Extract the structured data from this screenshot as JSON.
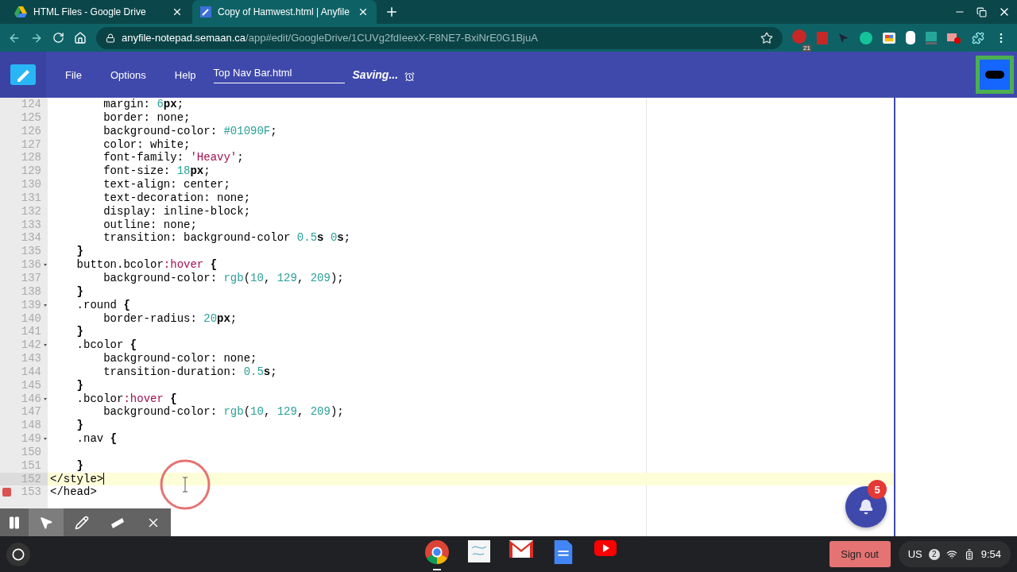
{
  "browser": {
    "tabs": [
      {
        "title": "HTML Files - Google Drive",
        "kind": "drive",
        "selected": false
      },
      {
        "title": "Copy of Hamwest.html | Anyfile",
        "kind": "notepad",
        "selected": true
      }
    ],
    "url": {
      "host": "anyfile-notepad.semaan.ca",
      "path": "/app#edit/GoogleDrive/1CUVg2fdIeexX-F8NE7-BxiNrE0G1BjuA"
    },
    "extension_badge": "21"
  },
  "app": {
    "menu": [
      "File",
      "Options",
      "Help"
    ],
    "filename": "Top Nav Bar.html",
    "status": "Saving..."
  },
  "editor": {
    "lines": [
      {
        "number": "124",
        "fold": false,
        "error": false,
        "current": false,
        "tokens": [
          {
            "kind": "plain",
            "text": "        margin: "
          },
          {
            "kind": "num",
            "text": "6"
          },
          {
            "kind": "bold",
            "text": "px"
          },
          {
            "kind": "plain",
            "text": ";"
          }
        ]
      },
      {
        "number": "125",
        "fold": false,
        "error": false,
        "current": false,
        "tokens": [
          {
            "kind": "plain",
            "text": "        border: none;"
          }
        ]
      },
      {
        "number": "126",
        "fold": false,
        "error": false,
        "current": false,
        "tokens": [
          {
            "kind": "plain",
            "text": "        background-color: "
          },
          {
            "kind": "num",
            "text": "#01090F"
          },
          {
            "kind": "plain",
            "text": ";"
          }
        ]
      },
      {
        "number": "127",
        "fold": false,
        "error": false,
        "current": false,
        "tokens": [
          {
            "kind": "plain",
            "text": "        color: white;"
          }
        ]
      },
      {
        "number": "128",
        "fold": false,
        "error": false,
        "current": false,
        "tokens": [
          {
            "kind": "plain",
            "text": "        font-family: "
          },
          {
            "kind": "string",
            "text": "'Heavy'"
          },
          {
            "kind": "plain",
            "text": ";"
          }
        ]
      },
      {
        "number": "129",
        "fold": false,
        "error": false,
        "current": false,
        "tokens": [
          {
            "kind": "plain",
            "text": "        font-size: "
          },
          {
            "kind": "num",
            "text": "18"
          },
          {
            "kind": "bold",
            "text": "px"
          },
          {
            "kind": "plain",
            "text": ";"
          }
        ]
      },
      {
        "number": "130",
        "fold": false,
        "error": false,
        "current": false,
        "tokens": [
          {
            "kind": "plain",
            "text": "        text-align: center;"
          }
        ]
      },
      {
        "number": "131",
        "fold": false,
        "error": false,
        "current": false,
        "tokens": [
          {
            "kind": "plain",
            "text": "        text-decoration: none;"
          }
        ]
      },
      {
        "number": "132",
        "fold": false,
        "error": false,
        "current": false,
        "tokens": [
          {
            "kind": "plain",
            "text": "        display: inline-block;"
          }
        ]
      },
      {
        "number": "133",
        "fold": false,
        "error": false,
        "current": false,
        "tokens": [
          {
            "kind": "plain",
            "text": "        outline: none;"
          }
        ]
      },
      {
        "number": "134",
        "fold": false,
        "error": false,
        "current": false,
        "tokens": [
          {
            "kind": "plain",
            "text": "        transition: background-color "
          },
          {
            "kind": "num",
            "text": "0.5"
          },
          {
            "kind": "bold",
            "text": "s"
          },
          {
            "kind": "num",
            "text": " 0"
          },
          {
            "kind": "bold",
            "text": "s"
          },
          {
            "kind": "plain",
            "text": ";"
          }
        ]
      },
      {
        "number": "135",
        "fold": false,
        "error": false,
        "current": false,
        "tokens": [
          {
            "kind": "bold",
            "text": "    }"
          }
        ]
      },
      {
        "number": "136",
        "fold": true,
        "error": false,
        "current": false,
        "tokens": [
          {
            "kind": "plain",
            "text": "    button.bcolor"
          },
          {
            "kind": "pseudo",
            "text": ":hover"
          },
          {
            "kind": "bold",
            "text": " {"
          }
        ]
      },
      {
        "number": "137",
        "fold": false,
        "error": false,
        "current": false,
        "tokens": [
          {
            "kind": "plain",
            "text": "        background-color: "
          },
          {
            "kind": "num",
            "text": "rgb"
          },
          {
            "kind": "plain",
            "text": "("
          },
          {
            "kind": "num",
            "text": "10"
          },
          {
            "kind": "plain",
            "text": ", "
          },
          {
            "kind": "num",
            "text": "129"
          },
          {
            "kind": "plain",
            "text": ", "
          },
          {
            "kind": "num",
            "text": "209"
          },
          {
            "kind": "plain",
            "text": ");"
          }
        ]
      },
      {
        "number": "138",
        "fold": false,
        "error": false,
        "current": false,
        "tokens": [
          {
            "kind": "bold",
            "text": "    }"
          }
        ]
      },
      {
        "number": "139",
        "fold": true,
        "error": false,
        "current": false,
        "tokens": [
          {
            "kind": "plain",
            "text": "    .round "
          },
          {
            "kind": "bold",
            "text": "{"
          }
        ]
      },
      {
        "number": "140",
        "fold": false,
        "error": false,
        "current": false,
        "tokens": [
          {
            "kind": "plain",
            "text": "        border-radius: "
          },
          {
            "kind": "num",
            "text": "20"
          },
          {
            "kind": "bold",
            "text": "px"
          },
          {
            "kind": "plain",
            "text": ";"
          }
        ]
      },
      {
        "number": "141",
        "fold": false,
        "error": false,
        "current": false,
        "tokens": [
          {
            "kind": "bold",
            "text": "    }"
          }
        ]
      },
      {
        "number": "142",
        "fold": true,
        "error": false,
        "current": false,
        "tokens": [
          {
            "kind": "plain",
            "text": "    .bcolor "
          },
          {
            "kind": "bold",
            "text": "{"
          }
        ]
      },
      {
        "number": "143",
        "fold": false,
        "error": false,
        "current": false,
        "tokens": [
          {
            "kind": "plain",
            "text": "        background-color: none;"
          }
        ]
      },
      {
        "number": "144",
        "fold": false,
        "error": false,
        "current": false,
        "tokens": [
          {
            "kind": "plain",
            "text": "        transition-duration: "
          },
          {
            "kind": "num",
            "text": "0.5"
          },
          {
            "kind": "bold",
            "text": "s"
          },
          {
            "kind": "plain",
            "text": ";"
          }
        ]
      },
      {
        "number": "145",
        "fold": false,
        "error": false,
        "current": false,
        "tokens": [
          {
            "kind": "bold",
            "text": "    }"
          }
        ]
      },
      {
        "number": "146",
        "fold": true,
        "error": false,
        "current": false,
        "tokens": [
          {
            "kind": "plain",
            "text": "    .bcolor"
          },
          {
            "kind": "pseudo",
            "text": ":hover"
          },
          {
            "kind": "bold",
            "text": " {"
          }
        ]
      },
      {
        "number": "147",
        "fold": false,
        "error": false,
        "current": false,
        "tokens": [
          {
            "kind": "plain",
            "text": "        background-color: "
          },
          {
            "kind": "num",
            "text": "rgb"
          },
          {
            "kind": "plain",
            "text": "("
          },
          {
            "kind": "num",
            "text": "10"
          },
          {
            "kind": "plain",
            "text": ", "
          },
          {
            "kind": "num",
            "text": "129"
          },
          {
            "kind": "plain",
            "text": ", "
          },
          {
            "kind": "num",
            "text": "209"
          },
          {
            "kind": "plain",
            "text": ");"
          }
        ]
      },
      {
        "number": "148",
        "fold": false,
        "error": false,
        "current": false,
        "tokens": [
          {
            "kind": "bold",
            "text": "    }"
          }
        ]
      },
      {
        "number": "149",
        "fold": true,
        "error": false,
        "current": false,
        "tokens": [
          {
            "kind": "plain",
            "text": "    .nav "
          },
          {
            "kind": "bold",
            "text": "{"
          }
        ]
      },
      {
        "number": "150",
        "fold": false,
        "error": false,
        "current": false
      },
      {
        "number": "151",
        "fold": false,
        "error": false,
        "current": false,
        "tokens": [
          {
            "kind": "bold",
            "text": "    }"
          }
        ]
      },
      {
        "number": "152",
        "fold": false,
        "error": false,
        "current": true,
        "tokens": [
          {
            "kind": "plain",
            "text": "</style>"
          }
        ]
      },
      {
        "number": "153",
        "fold": false,
        "error": true,
        "current": false,
        "tokens": [
          {
            "kind": "plain",
            "text": "</head>"
          }
        ]
      }
    ]
  },
  "notifications": {
    "count": "5"
  },
  "annotation_toolbar": {
    "tools": [
      {
        "kind": "pause",
        "selected": false
      },
      {
        "kind": "pointer",
        "selected": true
      },
      {
        "kind": "pen",
        "selected": false
      },
      {
        "kind": "marker",
        "selected": false
      },
      {
        "kind": "close",
        "selected": false
      }
    ]
  },
  "taskbar": {
    "apps": [
      {
        "kind": "chrome",
        "running": true
      },
      {
        "kind": "showme",
        "running": false
      },
      {
        "kind": "gmail",
        "running": false
      },
      {
        "kind": "docs",
        "running": false
      },
      {
        "kind": "youtube",
        "running": false
      }
    ],
    "sign_out": "Sign out",
    "keyboard": "US",
    "notification_count": "2",
    "time": "9:54"
  }
}
